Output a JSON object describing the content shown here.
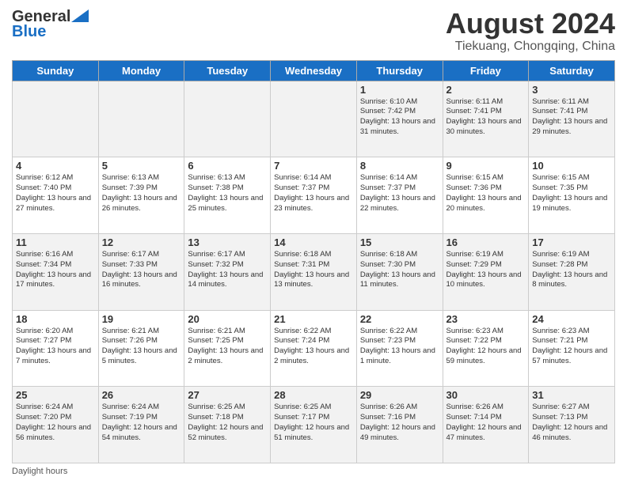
{
  "header": {
    "logo_general": "General",
    "logo_blue": "Blue",
    "month_title": "August 2024",
    "location": "Tiekuang, Chongqing, China"
  },
  "days_of_week": [
    "Sunday",
    "Monday",
    "Tuesday",
    "Wednesday",
    "Thursday",
    "Friday",
    "Saturday"
  ],
  "weeks": [
    [
      {
        "day": "",
        "detail": ""
      },
      {
        "day": "",
        "detail": ""
      },
      {
        "day": "",
        "detail": ""
      },
      {
        "day": "",
        "detail": ""
      },
      {
        "day": "1",
        "detail": "Sunrise: 6:10 AM\nSunset: 7:42 PM\nDaylight: 13 hours\nand 31 minutes."
      },
      {
        "day": "2",
        "detail": "Sunrise: 6:11 AM\nSunset: 7:41 PM\nDaylight: 13 hours\nand 30 minutes."
      },
      {
        "day": "3",
        "detail": "Sunrise: 6:11 AM\nSunset: 7:41 PM\nDaylight: 13 hours\nand 29 minutes."
      }
    ],
    [
      {
        "day": "4",
        "detail": "Sunrise: 6:12 AM\nSunset: 7:40 PM\nDaylight: 13 hours\nand 27 minutes."
      },
      {
        "day": "5",
        "detail": "Sunrise: 6:13 AM\nSunset: 7:39 PM\nDaylight: 13 hours\nand 26 minutes."
      },
      {
        "day": "6",
        "detail": "Sunrise: 6:13 AM\nSunset: 7:38 PM\nDaylight: 13 hours\nand 25 minutes."
      },
      {
        "day": "7",
        "detail": "Sunrise: 6:14 AM\nSunset: 7:37 PM\nDaylight: 13 hours\nand 23 minutes."
      },
      {
        "day": "8",
        "detail": "Sunrise: 6:14 AM\nSunset: 7:37 PM\nDaylight: 13 hours\nand 22 minutes."
      },
      {
        "day": "9",
        "detail": "Sunrise: 6:15 AM\nSunset: 7:36 PM\nDaylight: 13 hours\nand 20 minutes."
      },
      {
        "day": "10",
        "detail": "Sunrise: 6:15 AM\nSunset: 7:35 PM\nDaylight: 13 hours\nand 19 minutes."
      }
    ],
    [
      {
        "day": "11",
        "detail": "Sunrise: 6:16 AM\nSunset: 7:34 PM\nDaylight: 13 hours\nand 17 minutes."
      },
      {
        "day": "12",
        "detail": "Sunrise: 6:17 AM\nSunset: 7:33 PM\nDaylight: 13 hours\nand 16 minutes."
      },
      {
        "day": "13",
        "detail": "Sunrise: 6:17 AM\nSunset: 7:32 PM\nDaylight: 13 hours\nand 14 minutes."
      },
      {
        "day": "14",
        "detail": "Sunrise: 6:18 AM\nSunset: 7:31 PM\nDaylight: 13 hours\nand 13 minutes."
      },
      {
        "day": "15",
        "detail": "Sunrise: 6:18 AM\nSunset: 7:30 PM\nDaylight: 13 hours\nand 11 minutes."
      },
      {
        "day": "16",
        "detail": "Sunrise: 6:19 AM\nSunset: 7:29 PM\nDaylight: 13 hours\nand 10 minutes."
      },
      {
        "day": "17",
        "detail": "Sunrise: 6:19 AM\nSunset: 7:28 PM\nDaylight: 13 hours\nand 8 minutes."
      }
    ],
    [
      {
        "day": "18",
        "detail": "Sunrise: 6:20 AM\nSunset: 7:27 PM\nDaylight: 13 hours\nand 7 minutes."
      },
      {
        "day": "19",
        "detail": "Sunrise: 6:21 AM\nSunset: 7:26 PM\nDaylight: 13 hours\nand 5 minutes."
      },
      {
        "day": "20",
        "detail": "Sunrise: 6:21 AM\nSunset: 7:25 PM\nDaylight: 13 hours\nand 2 minutes."
      },
      {
        "day": "21",
        "detail": "Sunrise: 6:22 AM\nSunset: 7:24 PM\nDaylight: 13 hours\nand 2 minutes."
      },
      {
        "day": "22",
        "detail": "Sunrise: 6:22 AM\nSunset: 7:23 PM\nDaylight: 13 hours\nand 1 minute."
      },
      {
        "day": "23",
        "detail": "Sunrise: 6:23 AM\nSunset: 7:22 PM\nDaylight: 12 hours\nand 59 minutes."
      },
      {
        "day": "24",
        "detail": "Sunrise: 6:23 AM\nSunset: 7:21 PM\nDaylight: 12 hours\nand 57 minutes."
      }
    ],
    [
      {
        "day": "25",
        "detail": "Sunrise: 6:24 AM\nSunset: 7:20 PM\nDaylight: 12 hours\nand 56 minutes."
      },
      {
        "day": "26",
        "detail": "Sunrise: 6:24 AM\nSunset: 7:19 PM\nDaylight: 12 hours\nand 54 minutes."
      },
      {
        "day": "27",
        "detail": "Sunrise: 6:25 AM\nSunset: 7:18 PM\nDaylight: 12 hours\nand 52 minutes."
      },
      {
        "day": "28",
        "detail": "Sunrise: 6:25 AM\nSunset: 7:17 PM\nDaylight: 12 hours\nand 51 minutes."
      },
      {
        "day": "29",
        "detail": "Sunrise: 6:26 AM\nSunset: 7:16 PM\nDaylight: 12 hours\nand 49 minutes."
      },
      {
        "day": "30",
        "detail": "Sunrise: 6:26 AM\nSunset: 7:14 PM\nDaylight: 12 hours\nand 47 minutes."
      },
      {
        "day": "31",
        "detail": "Sunrise: 6:27 AM\nSunset: 7:13 PM\nDaylight: 12 hours\nand 46 minutes."
      }
    ]
  ],
  "footer": {
    "daylight_label": "Daylight hours"
  }
}
